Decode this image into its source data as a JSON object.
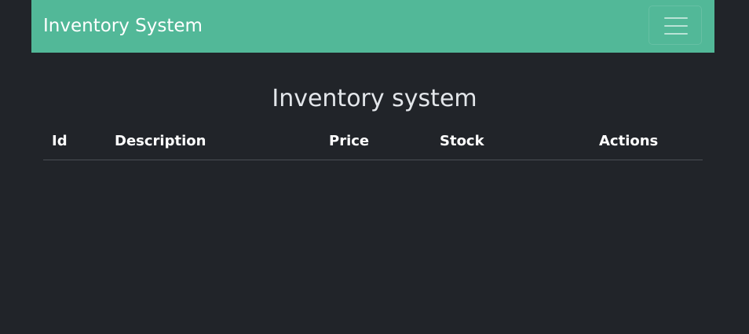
{
  "navbar": {
    "brand": "Inventory System",
    "toggler_icon": "hamburger-icon"
  },
  "page": {
    "title": "Inventory system"
  },
  "table": {
    "columns": [
      "Id",
      "Description",
      "Price",
      "Stock",
      "Actions"
    ],
    "rows": []
  },
  "colors": {
    "navbar_bg": "#52b898",
    "page_bg": "#212429",
    "text": "#ffffff"
  }
}
